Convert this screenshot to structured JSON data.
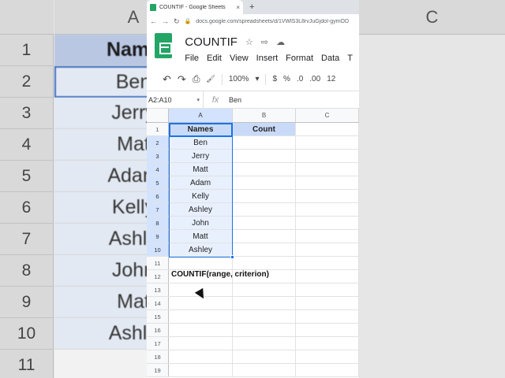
{
  "background": {
    "col_header_left": "A",
    "col_header_right": "C",
    "row_numbers": [
      "1",
      "2",
      "3",
      "4",
      "5",
      "6",
      "7",
      "8",
      "9",
      "10",
      "11"
    ],
    "cells": [
      "Name",
      "Ben",
      "Jerry",
      "Mat",
      "Adam",
      "Kelly",
      "Ashle",
      "John",
      "Mat",
      "Ashle",
      ""
    ]
  },
  "browser": {
    "tab_title": "COUNTIF - Google Sheets",
    "tab_close": "×",
    "new_tab": "+",
    "url": "docs.google.com/spreadsheets/d/1VWlS3L8rvJuGjdoI-gymOD",
    "back": "←",
    "forward": "→",
    "reload": "↻"
  },
  "app": {
    "doc_title": "COUNTIF",
    "star_icon": "☆",
    "move_icon": "⇨",
    "cloud_icon": "☁",
    "menus": [
      "File",
      "Edit",
      "View",
      "Insert",
      "Format",
      "Data",
      "T"
    ]
  },
  "toolbar": {
    "undo": "↶",
    "redo": "↷",
    "print": "⎙",
    "paint": "🖌",
    "zoom": "100%",
    "zoom_caret": "▾",
    "currency": "$",
    "percent": "%",
    "dec_decrease": ".0",
    "dec_increase": ".00",
    "more_formats": "12"
  },
  "formula_bar": {
    "name_box": "A2:A10",
    "name_caret": "▾",
    "fx": "fx",
    "content": "Ben"
  },
  "grid": {
    "columns": [
      "A",
      "B",
      "C"
    ],
    "rows": [
      {
        "n": "1",
        "a": "Names",
        "b": "Count"
      },
      {
        "n": "2",
        "a": "Ben",
        "b": ""
      },
      {
        "n": "3",
        "a": "Jerry",
        "b": ""
      },
      {
        "n": "4",
        "a": "Matt",
        "b": ""
      },
      {
        "n": "5",
        "a": "Adam",
        "b": ""
      },
      {
        "n": "6",
        "a": "Kelly",
        "b": ""
      },
      {
        "n": "7",
        "a": "Ashley",
        "b": ""
      },
      {
        "n": "8",
        "a": "John",
        "b": ""
      },
      {
        "n": "9",
        "a": "Matt",
        "b": ""
      },
      {
        "n": "10",
        "a": "Ashley",
        "b": ""
      },
      {
        "n": "11",
        "a": "",
        "b": ""
      },
      {
        "n": "12",
        "a": "",
        "b": ""
      },
      {
        "n": "13",
        "a": "",
        "b": ""
      },
      {
        "n": "14",
        "a": "",
        "b": ""
      },
      {
        "n": "15",
        "a": "",
        "b": ""
      },
      {
        "n": "16",
        "a": "",
        "b": ""
      },
      {
        "n": "17",
        "a": "",
        "b": ""
      },
      {
        "n": "18",
        "a": "",
        "b": ""
      },
      {
        "n": "19",
        "a": "",
        "b": ""
      }
    ],
    "note": "COUNTIF(range, criterion)"
  }
}
